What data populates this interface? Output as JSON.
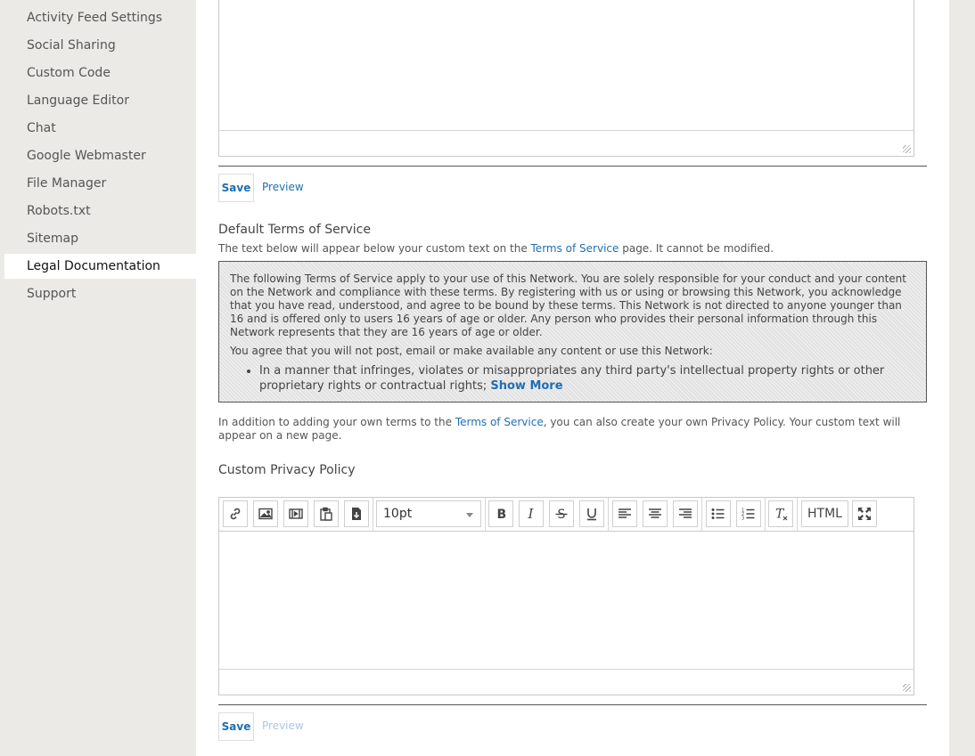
{
  "sidebar": {
    "items": [
      {
        "label": "Activity Feed Settings"
      },
      {
        "label": "Social Sharing"
      },
      {
        "label": "Custom Code"
      },
      {
        "label": "Language Editor"
      },
      {
        "label": "Chat"
      },
      {
        "label": "Google Webmaster"
      },
      {
        "label": "File Manager"
      },
      {
        "label": "Robots.txt"
      },
      {
        "label": "Sitemap"
      },
      {
        "label": "Legal Documentation"
      },
      {
        "label": "Support"
      }
    ],
    "active": "Legal Documentation"
  },
  "terms_editor": {
    "save_label": "Save",
    "preview_label": "Preview"
  },
  "default_tos": {
    "title": "Default Terms of Service",
    "help_before": "The text below will appear below your custom text on the ",
    "help_link": "Terms of Service",
    "help_after": " page. It cannot be modified.",
    "paragraph1": "The following Terms of Service apply to your use of this Network. You are solely responsible for your conduct and your content on the Network and compliance with these terms. By registering with us or using or browsing this Network, you acknowledge that you have read, understood, and agree to be bound by these terms. This Network is not directed to anyone younger than 16 and is offered only to users 16 years of age or older. Any person who provides their personal information through this Network represents that they are 16 years of age or older.",
    "paragraph2": "You agree that you will not post, email or make available any content or use this Network:",
    "bullet1": "In a manner that infringes, violates or misappropriates any third party's intellectual property rights or other proprietary rights or contractual rights; ",
    "show_more": "Show More"
  },
  "privacy": {
    "help_before": "In addition to adding your own terms to the ",
    "help_link": "Terms of Service",
    "help_after": ", you can also create your own Privacy Policy. Your custom text will appear on a new page.",
    "title": "Custom Privacy Policy",
    "font_size": "10pt",
    "html_label": "HTML",
    "save_label": "Save",
    "preview_label": "Preview"
  },
  "colors": {
    "link": "#1f6fb2",
    "sidebar_bg": "#eceae6"
  }
}
